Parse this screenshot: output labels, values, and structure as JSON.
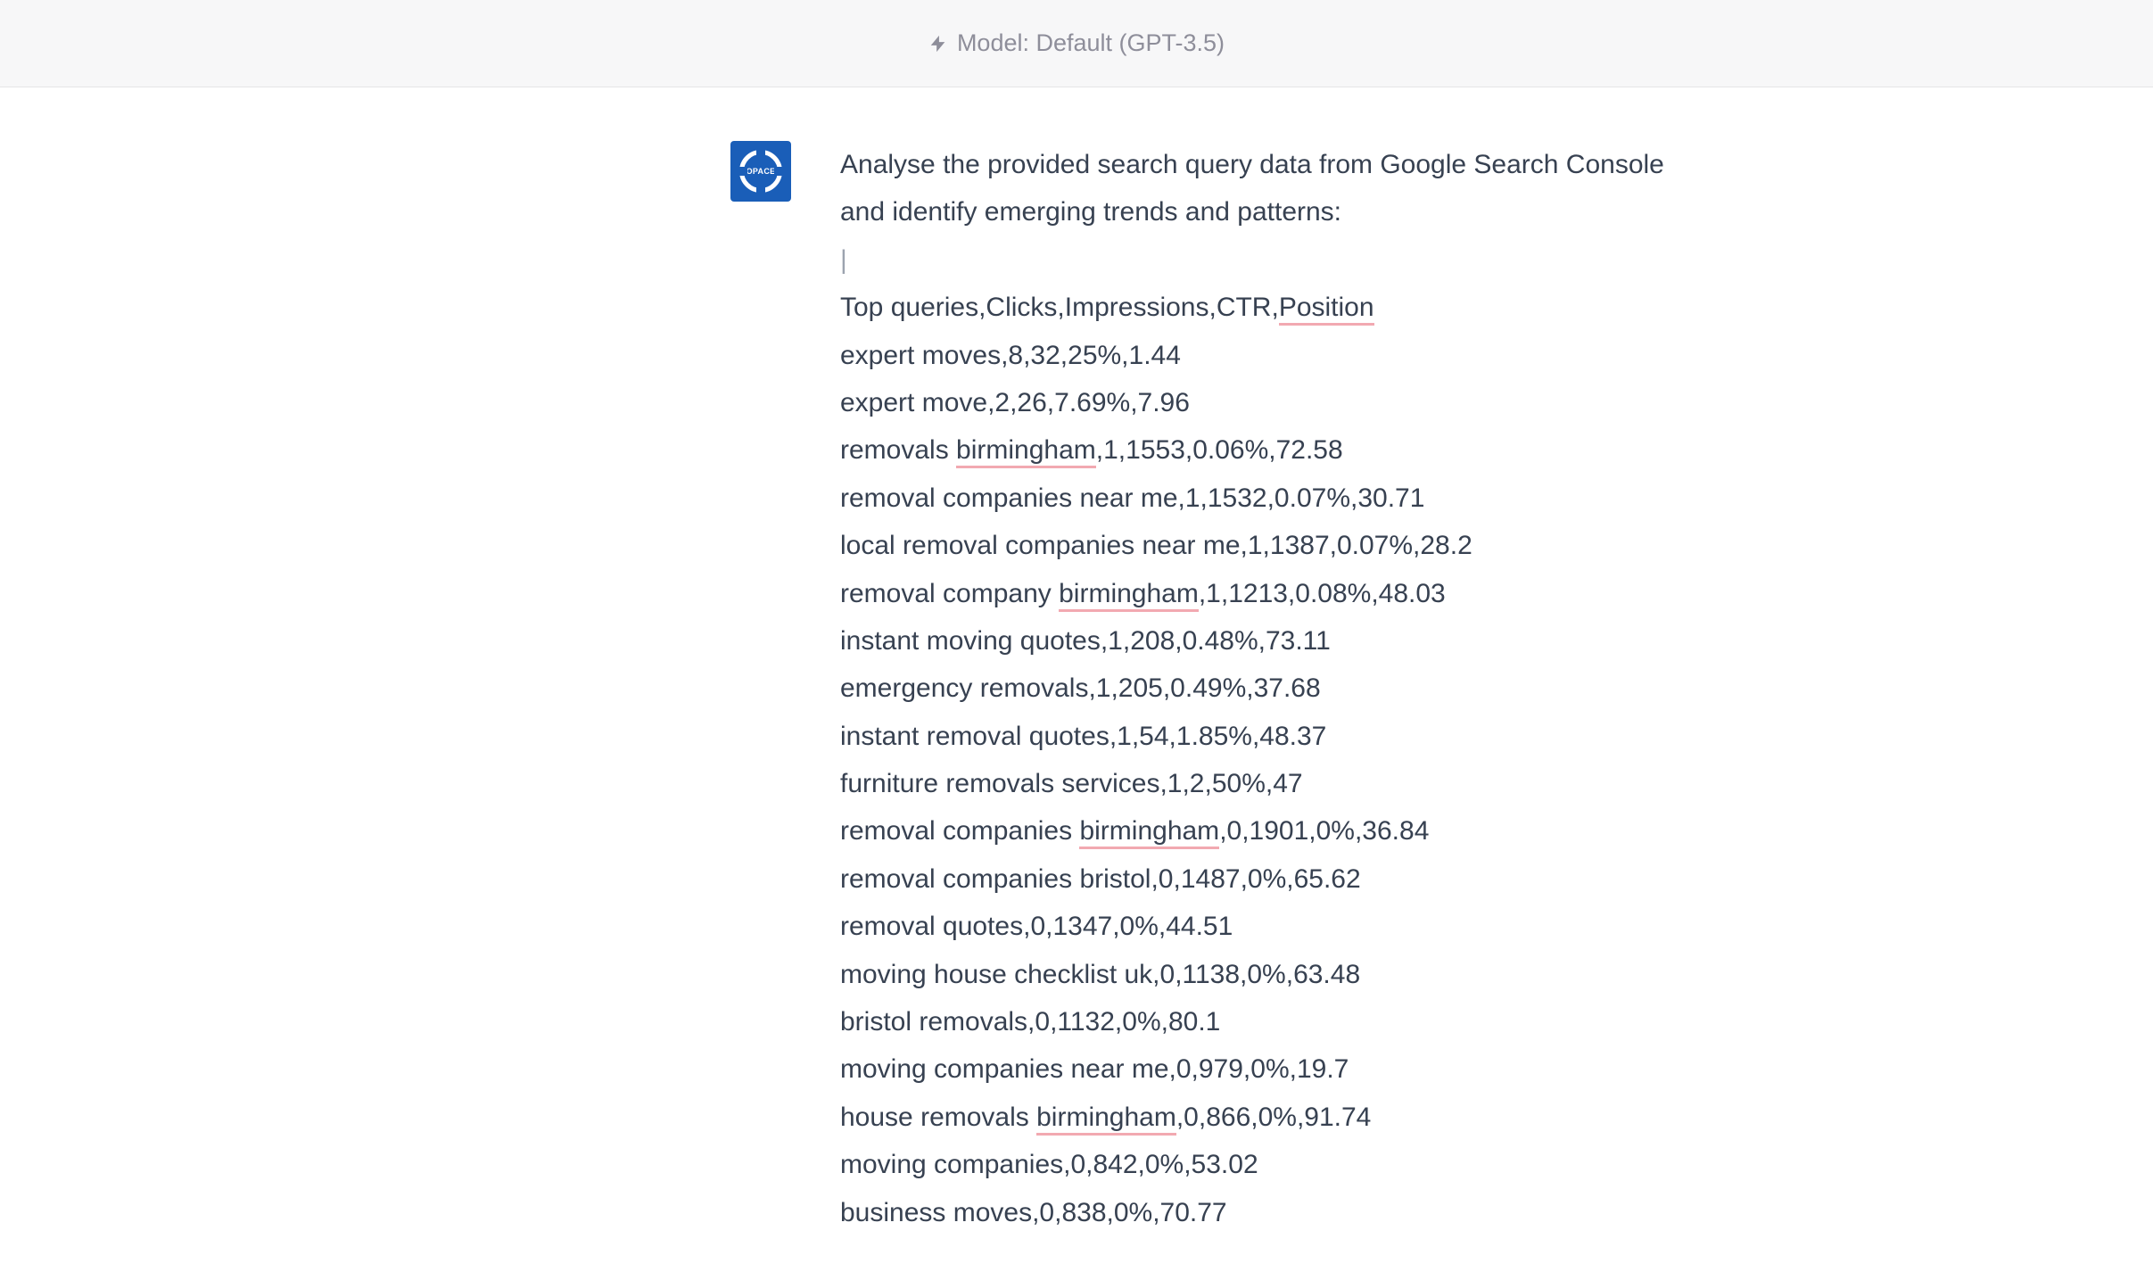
{
  "header": {
    "model_label": "Model: Default (GPT-3.5)"
  },
  "message": {
    "avatar_label": "OPACE",
    "prompt": "Analyse the provided search query data from Google Search Console and identify emerging trends and patterns:",
    "csv_header": {
      "prefix": "Top queries,Clicks,Impressions,CTR,",
      "underlined": "Position"
    },
    "rows": [
      {
        "segments": [
          {
            "t": "expert moves,8,32,25%,1.44"
          }
        ]
      },
      {
        "segments": [
          {
            "t": "expert move,2,26,7.69%,7.96"
          }
        ]
      },
      {
        "segments": [
          {
            "t": "removals "
          },
          {
            "t": "birmingham",
            "u": true
          },
          {
            "t": ",1,1553,0.06%,72.58"
          }
        ]
      },
      {
        "segments": [
          {
            "t": "removal companies near me,1,1532,0.07%,30.71"
          }
        ]
      },
      {
        "segments": [
          {
            "t": "local removal companies near me,1,1387,0.07%,28.2"
          }
        ]
      },
      {
        "segments": [
          {
            "t": "removal company "
          },
          {
            "t": "birmingham",
            "u": true
          },
          {
            "t": ",1,1213,0.08%,48.03"
          }
        ]
      },
      {
        "segments": [
          {
            "t": "instant moving quotes,1,208,0.48%,73.11"
          }
        ]
      },
      {
        "segments": [
          {
            "t": "emergency removals,1,205,0.49%,37.68"
          }
        ]
      },
      {
        "segments": [
          {
            "t": "instant removal quotes,1,54,1.85%,48.37"
          }
        ]
      },
      {
        "segments": [
          {
            "t": "furniture removals services,1,2,50%,47"
          }
        ]
      },
      {
        "segments": [
          {
            "t": "removal companies "
          },
          {
            "t": "birmingham",
            "u": true
          },
          {
            "t": ",0,1901,0%,36.84"
          }
        ]
      },
      {
        "segments": [
          {
            "t": "removal companies bristol,0,1487,0%,65.62"
          }
        ]
      },
      {
        "segments": [
          {
            "t": "removal quotes,0,1347,0%,44.51"
          }
        ]
      },
      {
        "segments": [
          {
            "t": "moving house checklist uk,0,1138,0%,63.48"
          }
        ]
      },
      {
        "segments": [
          {
            "t": "bristol removals,0,1132,0%,80.1"
          }
        ]
      },
      {
        "segments": [
          {
            "t": "moving companies near me,0,979,0%,19.7"
          }
        ]
      },
      {
        "segments": [
          {
            "t": "house removals "
          },
          {
            "t": "birmingham",
            "u": true
          },
          {
            "t": ",0,866,0%,91.74"
          }
        ]
      },
      {
        "segments": [
          {
            "t": "moving companies,0,842,0%,53.02"
          }
        ]
      },
      {
        "segments": [
          {
            "t": "business moves,0,838,0%,70.77"
          }
        ]
      }
    ]
  }
}
